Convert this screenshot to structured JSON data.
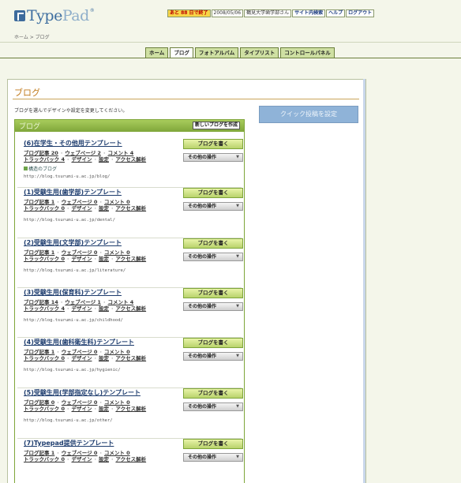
{
  "header": {
    "logo_main": "Type",
    "logo_accent": "Pad",
    "logo_reg": "®",
    "alert": "あと 88 日で終了",
    "date": "2008/05/06",
    "user": "鶴見大学歯学部さん",
    "site_search": "サイト内検索",
    "help": "ヘルプ",
    "logout": "ログアウト"
  },
  "breadcrumb": "ホーム > ブログ",
  "tabs": [
    {
      "label": "ホーム"
    },
    {
      "label": "ブログ"
    },
    {
      "label": "フォトアルバム"
    },
    {
      "label": "タイプリスト"
    },
    {
      "label": "コントロールパネル"
    }
  ],
  "main": {
    "title": "ブログ",
    "description": "ブログを選んでデザインや設定を変更してください。",
    "quick_post_button": "クイック投稿を設定",
    "box_title": "ブログ",
    "new_blog_button": "新しいブログを作成",
    "write_label": "ブログを書く",
    "ops_label": "その他の操作"
  },
  "blogs": [
    {
      "name": "(6)在学生・その他用テンプレート",
      "posts": "ブログ記事 20",
      "pages": "ウェブページ 2",
      "comments": "コメント 4",
      "trackbacks": "トラックバック 4",
      "design": "デザイン",
      "settings": "設定",
      "access": "アクセス解析",
      "sub": "構造のブログ",
      "url": "http://blog.tsurumi-u.ac.jp/blog/"
    },
    {
      "name": "(1)受験生用(歯学部)テンプレート",
      "posts": "ブログ記事 1",
      "pages": "ウェブページ 0",
      "comments": "コメント 0",
      "trackbacks": "トラックバック 0",
      "design": "デザイン",
      "settings": "設定",
      "access": "アクセス解析",
      "url": "http://blog.tsurumi-u.ac.jp/dental/"
    },
    {
      "name": "(2)受験生用(文学部)テンプレート",
      "posts": "ブログ記事 1",
      "pages": "ウェブページ 0",
      "comments": "コメント 0",
      "trackbacks": "トラックバック 0",
      "design": "デザイン",
      "settings": "設定",
      "access": "アクセス解析",
      "url": "http://blog.tsurumi-u.ac.jp/literature/"
    },
    {
      "name": "(3)受験生用(保育科)テンプレート",
      "posts": "ブログ記事 14",
      "pages": "ウェブページ 1",
      "comments": "コメント 4",
      "trackbacks": "トラックバック 4",
      "design": "デザイン",
      "settings": "設定",
      "access": "アクセス解析",
      "url": "http://blog.tsurumi-u.ac.jp/childhood/"
    },
    {
      "name": "(4)受験生用(歯科衛生科)テンプレート",
      "posts": "ブログ記事 1",
      "pages": "ウェブページ 0",
      "comments": "コメント 0",
      "trackbacks": "トラックバック 0",
      "design": "デザイン",
      "settings": "設定",
      "access": "アクセス解析",
      "url": "http://blog.tsurumi-u.ac.jp/hygienic/"
    },
    {
      "name": "(5)受験生用(学部指定なし)テンプレート",
      "posts": "ブログ記事 0",
      "pages": "ウェブページ 0",
      "comments": "コメント 0",
      "trackbacks": "トラックバック 0",
      "design": "デザイン",
      "settings": "設定",
      "access": "アクセス解析",
      "url": "http://blog.tsurumi-u.ac.jp/other/"
    },
    {
      "name": "(7)Typepad提供テンプレート",
      "posts": "ブログ記事 1",
      "pages": "ウェブページ 0",
      "comments": "コメント 0",
      "trackbacks": "トラックバック 0",
      "design": "デザイン",
      "settings": "設定",
      "access": "アクセス解析",
      "url": ""
    }
  ]
}
